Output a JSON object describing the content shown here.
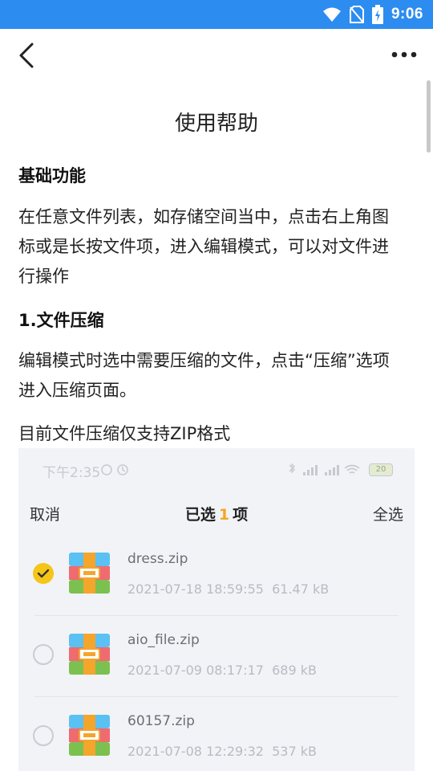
{
  "status_bar": {
    "time": "9:06"
  },
  "header": {
    "back_icon": "chevron-left-icon",
    "more_icon": "more-dots-icon"
  },
  "page": {
    "title": "使用帮助",
    "sections": [
      {
        "heading": "基础功能",
        "body": [
          "在任意文件列表，如存储空间当中，点击右上角图",
          "标或是长按文件项，进入编辑模式，可以对文件进",
          "行操作"
        ]
      },
      {
        "heading": "1.文件压缩",
        "body": [
          "编辑模式时选中需要压缩的文件，点击“压缩”选项",
          "进入压缩页面。"
        ],
        "note": "目前文件压缩仅支持ZIP格式"
      }
    ]
  },
  "embedded_screenshot": {
    "status_time": "下午2:35",
    "battery": "20",
    "toolbar": {
      "cancel": "取消",
      "selected_prefix": "已选",
      "selected_count": "1",
      "selected_suffix": "项",
      "select_all": "全选"
    },
    "files": [
      {
        "name": "dress.zip",
        "date": "2021-07-18 18:59:55",
        "size": "61.47 kB",
        "checked": true
      },
      {
        "name": "aio_file.zip",
        "date": "2021-07-09 08:17:17",
        "size": "689 kB",
        "checked": false
      },
      {
        "name": "60157.zip",
        "date": "2021-07-08 12:29:32",
        "size": "537 kB",
        "checked": false
      }
    ]
  },
  "colors": {
    "status_bar": "#2d8cf0",
    "accent": "#f5a623",
    "check": "#f5c518"
  }
}
